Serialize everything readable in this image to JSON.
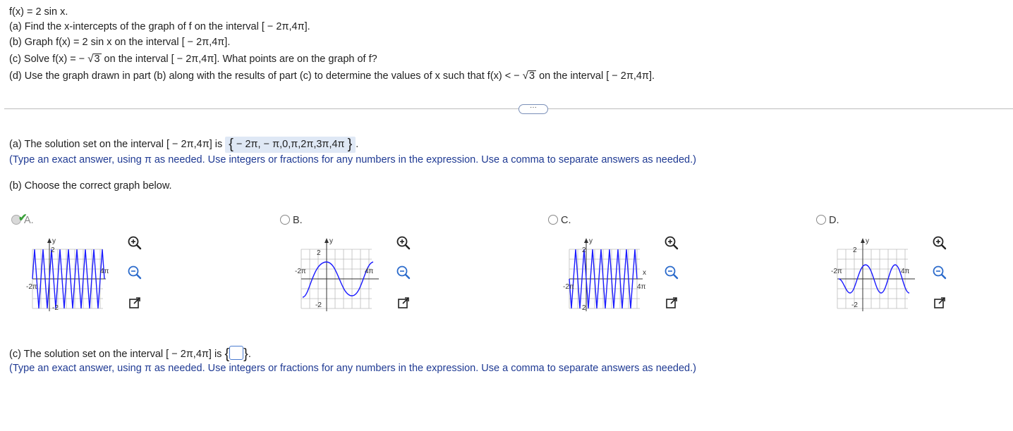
{
  "question": {
    "title": "f(x) = 2 sin x.",
    "a": "(a) Find the x-intercepts of the graph of f on the interval [ − 2π,4π].",
    "b": "(b) Graph f(x) = 2 sin x on the interval [ − 2π,4π].",
    "c_pre": "(c) Solve f(x) = −",
    "c_rad": "3",
    "c_post": " on the interval [ − 2π,4π]. What points are on the graph of f?",
    "d_pre": "(d) Use the graph drawn in part (b) along with the results of part (c) to determine the values of x such that f(x) < −",
    "d_rad": "3",
    "d_post": " on the interval [ − 2π,4π]."
  },
  "more_button": "···",
  "part_a": {
    "prefix": "(a) The solution set on the interval [ − 2π,4π] is",
    "answer": " − 2π, − π,0,π,2π,3π,4π ",
    "hint": "(Type an exact answer, using π as needed. Use integers or fractions for any numbers in the expression. Use a comma to separate answers as needed.)"
  },
  "part_b": {
    "prompt": "(b) Choose the correct graph below.",
    "options": [
      {
        "label": "A.",
        "selected": true,
        "ticks": {
          "y_top": "2",
          "y_bottom": "-2",
          "x_left": "-2π",
          "x_right": "4π",
          "x_axis": "x",
          "y_axis": "y"
        }
      },
      {
        "label": "B.",
        "selected": false,
        "ticks": {
          "y_top": "2",
          "y_bottom": "-2",
          "x_left": "-2π",
          "x_right": "4π",
          "x_axis": "x",
          "y_axis": "y"
        }
      },
      {
        "label": "C.",
        "selected": false,
        "ticks": {
          "y_top": "2",
          "y_bottom": "2",
          "x_left": "-2π",
          "x_right": "4π",
          "x_axis": "x",
          "y_axis": "y"
        }
      },
      {
        "label": "D.",
        "selected": false,
        "ticks": {
          "y_top": "2",
          "y_bottom": "-2",
          "x_left": "-2π",
          "x_right": "4π",
          "x_axis": "x",
          "y_axis": "y"
        }
      }
    ]
  },
  "part_c": {
    "prefix": "(c) The solution set on the interval [ − 2π,4π] is",
    "hint": "(Type an exact answer, using π as needed. Use integers or fractions for any numbers in the expression. Use a comma to separate answers as needed.)"
  },
  "icons": [
    "zoom-in-icon",
    "zoom-out-icon",
    "open-external-icon",
    "check-icon"
  ],
  "colors": {
    "curve": "#1a1aff",
    "hint": "#1f3a93",
    "answer_bg": "#dfe8f5",
    "check": "#3aa03a"
  }
}
